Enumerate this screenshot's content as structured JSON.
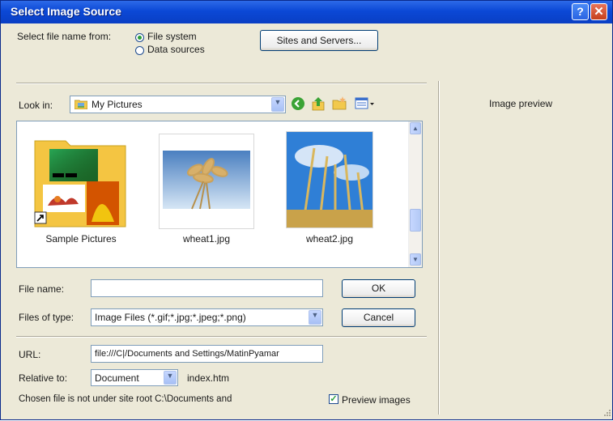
{
  "window": {
    "title": "Select Image Source",
    "help_glyph": "?",
    "close_glyph": "✕"
  },
  "source": {
    "label": "Select file name from:",
    "options": [
      "File system",
      "Data sources"
    ],
    "selected": "File system",
    "sites_button": "Sites and Servers..."
  },
  "look_in": {
    "label": "Look in:",
    "value": "My Pictures"
  },
  "files": [
    {
      "name": "Sample Pictures",
      "kind": "folder"
    },
    {
      "name": "wheat1.jpg",
      "kind": "image"
    },
    {
      "name": "wheat2.jpg",
      "kind": "image"
    }
  ],
  "file_name": {
    "label": "File name:",
    "value": ""
  },
  "files_of_type": {
    "label": "Files of type:",
    "value": "Image Files (*.gif;*.jpg;*.jpeg;*.png)"
  },
  "buttons": {
    "ok": "OK",
    "cancel": "Cancel"
  },
  "url": {
    "label": "URL:",
    "value": "file:///C|/Documents and Settings/MatinPyamar"
  },
  "relative_to": {
    "label": "Relative to:",
    "value": "Document",
    "page": "index.htm"
  },
  "note": "Chosen file is not under site root C:\\Documents and",
  "preview": {
    "checkbox_label": "Preview images",
    "checked": true,
    "pane_label": "Image preview"
  },
  "colors": {
    "title_bar": "#0b48d6",
    "dialog_bg": "#ece9d8",
    "radio_dot": "#2a9d3a"
  }
}
